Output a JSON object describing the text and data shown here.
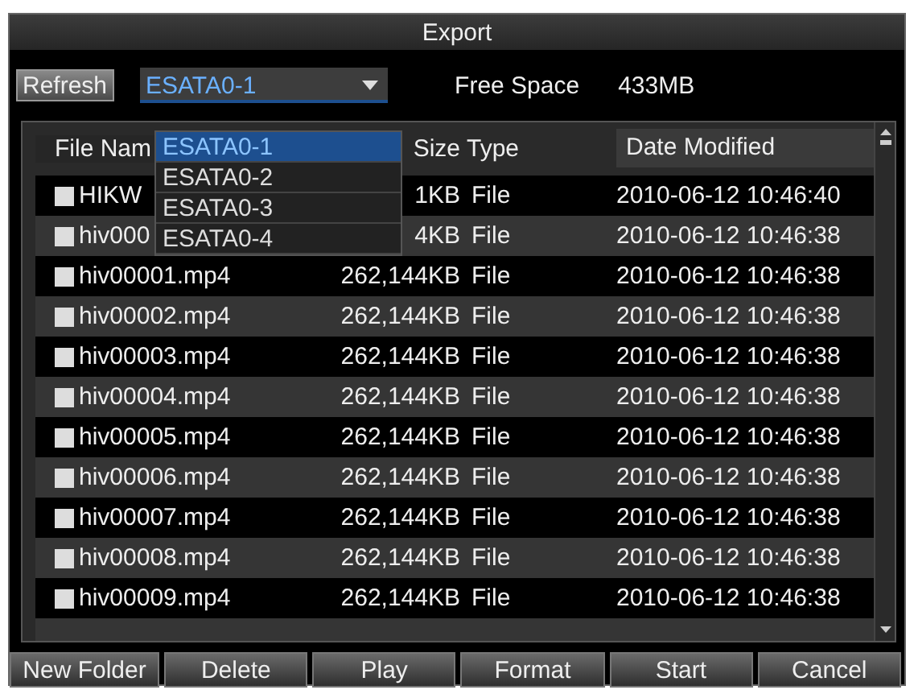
{
  "window": {
    "title": "Export"
  },
  "toolbar": {
    "refresh_button": "Refresh",
    "device": {
      "value": "ESATA0-1",
      "expanded": true,
      "options": [
        {
          "label": "ESATA0-1",
          "selected": true
        },
        {
          "label": "ESATA0-2",
          "selected": false
        },
        {
          "label": "ESATA0-3",
          "selected": false
        },
        {
          "label": "ESATA0-4",
          "selected": false
        }
      ]
    },
    "free_space_label": "Free Space",
    "free_space_value": "433MB"
  },
  "table": {
    "columns": [
      "File Nam",
      "Size",
      "Type",
      "Date Modified"
    ],
    "rows": [
      {
        "name": "HIKW",
        "size": "1KB",
        "type": "File",
        "date": "2010-06-12 10:46:40"
      },
      {
        "name": "hiv000",
        "size": "4KB",
        "type": "File",
        "date": "2010-06-12 10:46:38"
      },
      {
        "name": "hiv00001.mp4",
        "size": "262,144KB",
        "type": "File",
        "date": "2010-06-12 10:46:38"
      },
      {
        "name": "hiv00002.mp4",
        "size": "262,144KB",
        "type": "File",
        "date": "2010-06-12 10:46:38"
      },
      {
        "name": "hiv00003.mp4",
        "size": "262,144KB",
        "type": "File",
        "date": "2010-06-12 10:46:38"
      },
      {
        "name": "hiv00004.mp4",
        "size": "262,144KB",
        "type": "File",
        "date": "2010-06-12 10:46:38"
      },
      {
        "name": "hiv00005.mp4",
        "size": "262,144KB",
        "type": "File",
        "date": "2010-06-12 10:46:38"
      },
      {
        "name": "hiv00006.mp4",
        "size": "262,144KB",
        "type": "File",
        "date": "2010-06-12 10:46:38"
      },
      {
        "name": "hiv00007.mp4",
        "size": "262,144KB",
        "type": "File",
        "date": "2010-06-12 10:46:38"
      },
      {
        "name": "hiv00008.mp4",
        "size": "262,144KB",
        "type": "File",
        "date": "2010-06-12 10:46:38"
      },
      {
        "name": "hiv00009.mp4",
        "size": "262,144KB",
        "type": "File",
        "date": "2010-06-12 10:46:38"
      }
    ]
  },
  "buttons": [
    "New Folder",
    "Delete",
    "Play",
    "Format",
    "Start",
    "Cancel"
  ]
}
